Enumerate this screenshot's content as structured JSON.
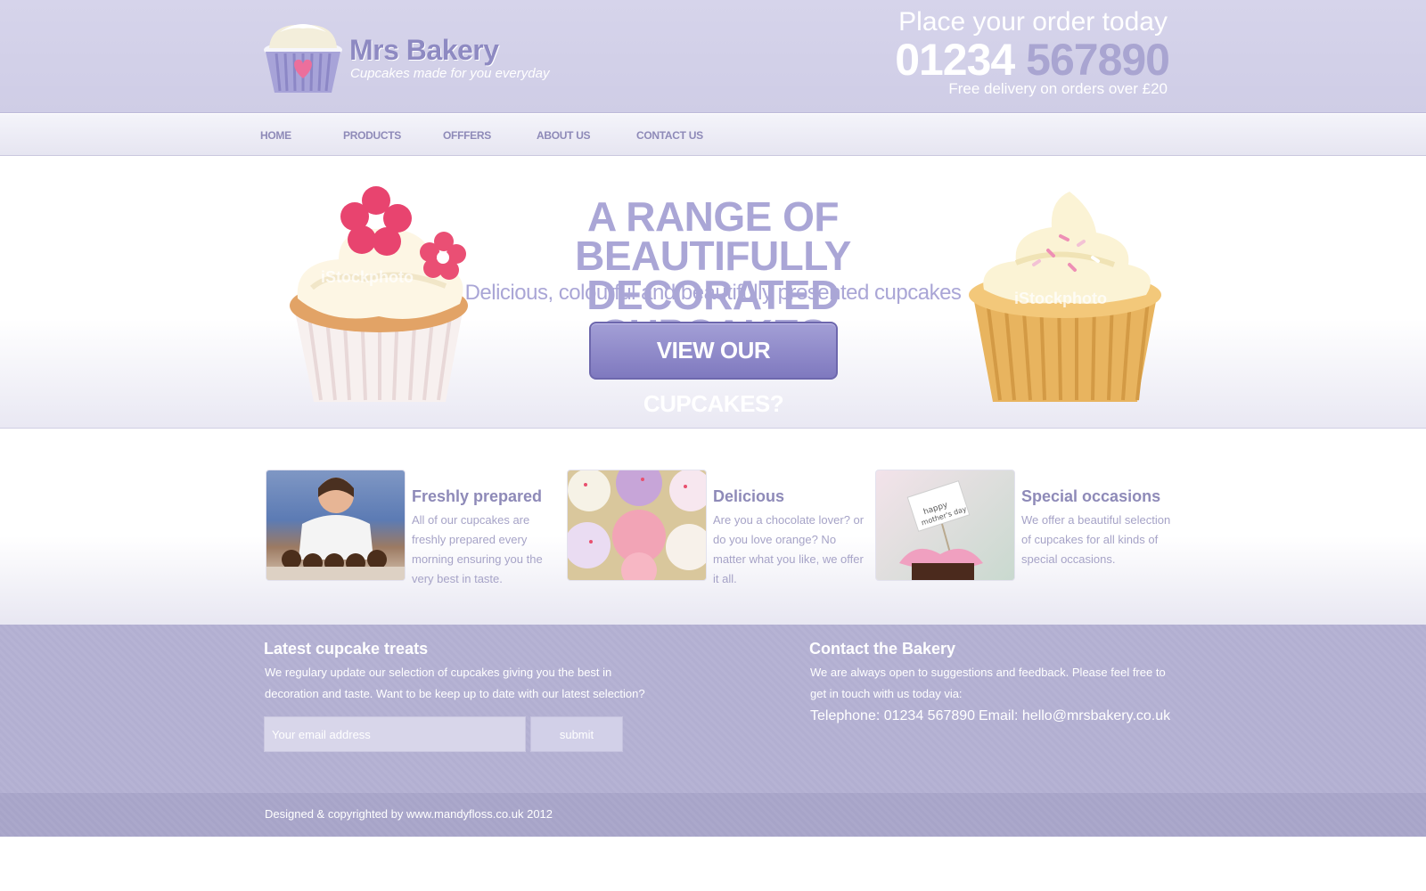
{
  "header": {
    "brand_name": "Mrs Bakery",
    "tagline": "Cupcakes made for you everyday",
    "order_text": "Place your order today",
    "phone_part1": "01234",
    "phone_part2": "567890",
    "delivery": "Free delivery on orders over £20"
  },
  "nav": {
    "items": [
      {
        "label": "HOME"
      },
      {
        "label": "PRODUCTS"
      },
      {
        "label": "OFFFERS"
      },
      {
        "label": "ABOUT US"
      },
      {
        "label": "CONTACT US"
      }
    ]
  },
  "hero": {
    "title_line1": "A RANGE OF BEAUTIFULLY",
    "title_line2": "DECORATED CUPCAKES",
    "subtitle": "Delicious, colourful and beautifully presented cupcakes",
    "button_label": "VIEW OUR CUPCAKES?",
    "watermark": "iStockphoto"
  },
  "features": [
    {
      "title": "Freshly prepared",
      "text": "All of our cupcakes are freshly prepared every morning ensuring you the very best in taste."
    },
    {
      "title": "Delicious",
      "text": "Are you a chocolate lover? or do you love orange? No matter what you like, we offer it all."
    },
    {
      "title": "Special occasions",
      "text": "We offer a beautiful selection of cupcakes for all kinds of special occasions."
    }
  ],
  "footer": {
    "latest_title": "Latest cupcake treats",
    "latest_text": "We regulary update our selection of cupcakes giving you the best in decoration and taste.  Want to be keep up to date with our latest selection?",
    "email_placeholder": "Your email address",
    "submit_label": "submit",
    "contact_title": "Contact the Bakery",
    "contact_text": "We are always open to suggestions and feedback. Please feel free to get in touch with us today via:",
    "telephone": "Telephone: 01234 567890",
    "email": "Email: hello@mrsbakery.co.uk",
    "copyright": "Designed & copyrighted by www.mandyfloss.co.uk 2012"
  },
  "colors": {
    "accent": "#8e8ac2",
    "light_accent": "#aaa6d6",
    "header_bg": "#d3d1e9",
    "footer_bg": "#b4b1d2"
  }
}
